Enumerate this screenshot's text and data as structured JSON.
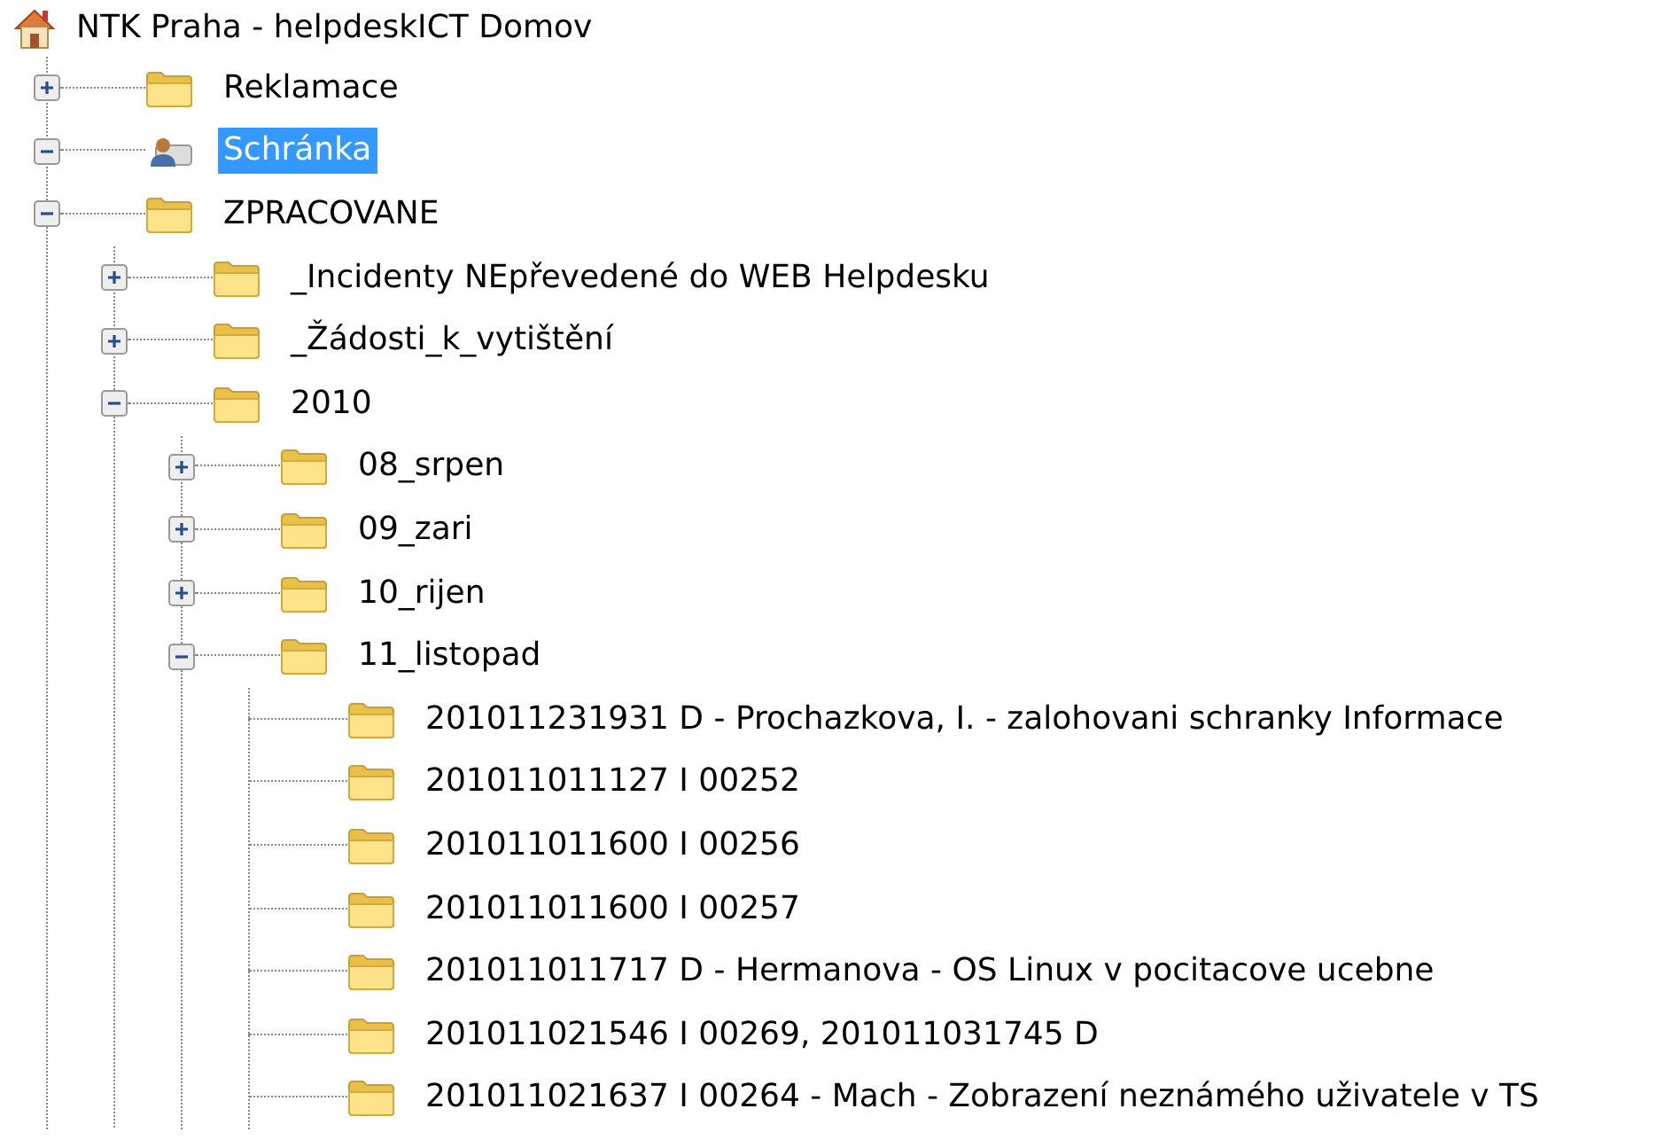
{
  "tree": {
    "label": "NTK Praha - helpdeskICT Domov",
    "kind": "home",
    "selected": false,
    "children": [
      {
        "label": "Reklamace",
        "kind": "folder",
        "expanded": false,
        "selected": false
      },
      {
        "label": "Schránka",
        "kind": "mailbox",
        "expanded": true,
        "selected": true
      },
      {
        "label": "ZPRACOVANE",
        "kind": "folder",
        "expanded": true,
        "selected": false,
        "children": [
          {
            "label": "_Incidenty NEpřevedené do WEB Helpdesku",
            "kind": "folder",
            "expanded": false,
            "selected": false
          },
          {
            "label": "_Žádosti_k_vytištění",
            "kind": "folder",
            "expanded": false,
            "selected": false
          },
          {
            "label": "2010",
            "kind": "folder",
            "expanded": true,
            "selected": false,
            "children": [
              {
                "label": "08_srpen",
                "kind": "folder",
                "expanded": false,
                "selected": false
              },
              {
                "label": "09_zari",
                "kind": "folder",
                "expanded": false,
                "selected": false
              },
              {
                "label": "10_rijen",
                "kind": "folder",
                "expanded": false,
                "selected": false
              },
              {
                "label": "11_listopad",
                "kind": "folder",
                "expanded": true,
                "selected": false,
                "children": [
                  {
                    "label": "201011231931 D - Prochazkova, I. - zalohovani schranky Informace",
                    "kind": "folder",
                    "selected": false
                  },
                  {
                    "label": "201011011127 I 00252",
                    "kind": "folder",
                    "selected": false
                  },
                  {
                    "label": "201011011600 I 00256",
                    "kind": "folder",
                    "selected": false
                  },
                  {
                    "label": "201011011600 I 00257",
                    "kind": "folder",
                    "selected": false
                  },
                  {
                    "label": "201011011717 D - Hermanova - OS Linux v pocitacove ucebne",
                    "kind": "folder",
                    "selected": false
                  },
                  {
                    "label": "201011021546 I 00269, 201011031745 D",
                    "kind": "folder",
                    "selected": false
                  },
                  {
                    "label": "201011021637 I 00264 - Mach - Zobrazení neznámého uživatele v TS",
                    "kind": "folder",
                    "selected": false
                  }
                ]
              }
            ]
          }
        ]
      }
    ]
  }
}
